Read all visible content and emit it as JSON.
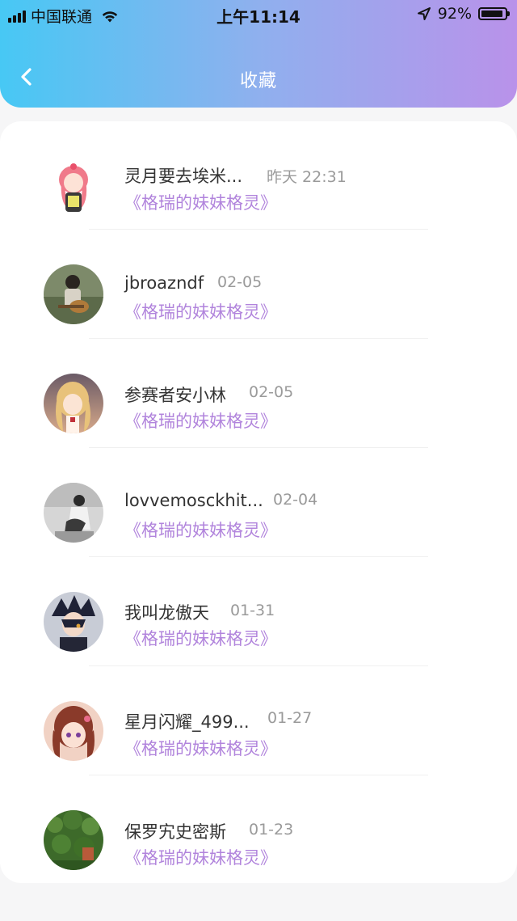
{
  "status_bar": {
    "carrier": "中国联通",
    "time": "上午11:14",
    "battery": "92%",
    "battery_level": 0.92
  },
  "header": {
    "title": "收藏",
    "back_icon": "chevron-left-icon"
  },
  "items": [
    {
      "name": "灵月要去埃米...",
      "time": "昨天 22:31",
      "book": "《格瑞的妹妹格灵》"
    },
    {
      "name": "jbroazndf",
      "time": "02-05",
      "book": "《格瑞的妹妹格灵》"
    },
    {
      "name": "参赛者安小林",
      "time": "02-05",
      "book": "《格瑞的妹妹格灵》"
    },
    {
      "name": "lovvemosckhit...",
      "time": "02-04",
      "book": "《格瑞的妹妹格灵》"
    },
    {
      "name": "我叫龙傲天",
      "time": "01-31",
      "book": "《格瑞的妹妹格灵》"
    },
    {
      "name": "星月闪耀_499...",
      "time": "01-27",
      "book": "《格瑞的妹妹格灵》"
    },
    {
      "name": "保罗宄史密斯",
      "time": "01-23",
      "book": "《格瑞的妹妹格灵》"
    }
  ]
}
